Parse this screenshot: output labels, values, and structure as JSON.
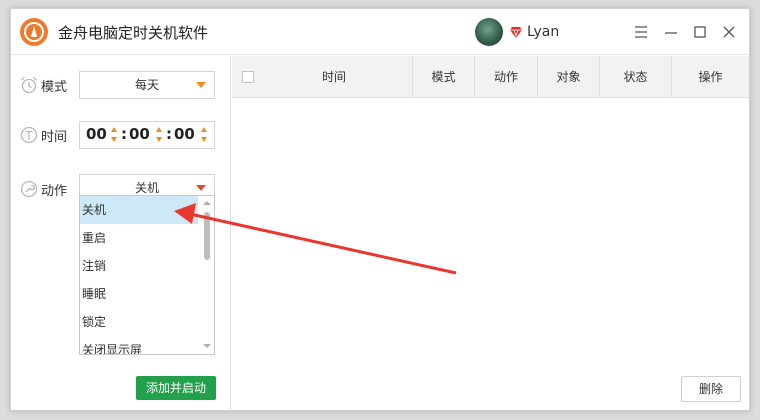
{
  "app": {
    "title": "金舟电脑定时关机软件",
    "user_name": "Lyan",
    "accent_color": "#f07a2c",
    "button_green": "#22a04b",
    "arrow_color": "#e8372c"
  },
  "form": {
    "mode_label": "模式",
    "mode_value": "每天",
    "time_label": "时间",
    "time_hour": "00",
    "time_minute": "00",
    "time_second": "00",
    "time_separator": ":",
    "action_label": "动作",
    "action_value": "关机",
    "action_options": [
      "关机",
      "重启",
      "注销",
      "睡眠",
      "锁定",
      "关闭显示屏"
    ],
    "add_button": "添加并启动"
  },
  "table": {
    "columns": [
      "时间",
      "模式",
      "动作",
      "对象",
      "状态",
      "操作"
    ],
    "rows": [],
    "delete_button": "删除"
  },
  "icons": {
    "logo": "app-logo-icon",
    "mode": "alarm-clock-icon",
    "time": "clock-t-icon",
    "action": "wrench-icon",
    "vip": "diamond-vip-icon"
  }
}
